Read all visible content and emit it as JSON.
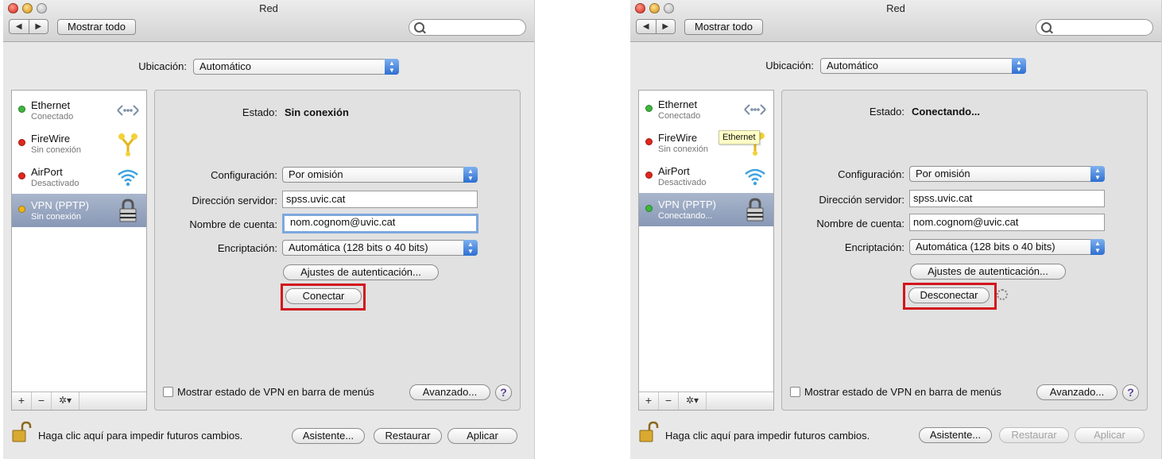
{
  "window_title": "Red",
  "toolbar": {
    "back": "◀",
    "forward": "▶",
    "show_all": "Mostrar todo"
  },
  "location": {
    "label": "Ubicación:",
    "value": "Automático"
  },
  "services": [
    {
      "name": "Ethernet",
      "status": "Conectado",
      "color": "#3db73d",
      "icon": "ethernet-icon"
    },
    {
      "name": "FireWire",
      "status": "Sin conexión",
      "color": "#e0261c",
      "icon": "firewire-icon"
    },
    {
      "name": "AirPort",
      "status": "Desactivado",
      "color": "#e0261c",
      "icon": "airport-icon"
    },
    {
      "name": "VPN (PPTP)",
      "status": "Sin conexión",
      "color": "#f0b51a",
      "icon": "lock-icon"
    }
  ],
  "sidebar_buttons": {
    "add": "+",
    "remove": "−",
    "gear": "✲▾"
  },
  "form": {
    "status_label": "Estado:",
    "config_label": "Configuración:",
    "config_value": "Por omisión",
    "server_label": "Dirección servidor:",
    "server_value": "spss.uvic.cat",
    "account_label": "Nombre de cuenta:",
    "account_value": "nom.cognom@uvic.cat",
    "encryption_label": "Encriptación:",
    "encryption_value": "Automática (128 bits o 40 bits)",
    "auth_button": "Ajustes de autenticación...",
    "show_vpn_label": "Mostrar estado de VPN en barra de menús",
    "advanced_button": "Avanzado...",
    "help": "?"
  },
  "footer": {
    "lock_text": "Haga clic aquí para impedir futuros cambios.",
    "assistant": "Asistente...",
    "revert": "Restaurar",
    "apply": "Aplicar"
  },
  "left": {
    "status_value": "Sin conexión",
    "action_button": "Conectar"
  },
  "right": {
    "status_value": "Conectando...",
    "vpn_status": "Conectando...",
    "vpn_color": "#3db73d",
    "action_button": "Desconectar",
    "tooltip": "Ethernet"
  },
  "colors": {
    "highlight": "#d3141c",
    "selected_row": "#8898b6",
    "popup_arrow": "#2e6fd1"
  }
}
